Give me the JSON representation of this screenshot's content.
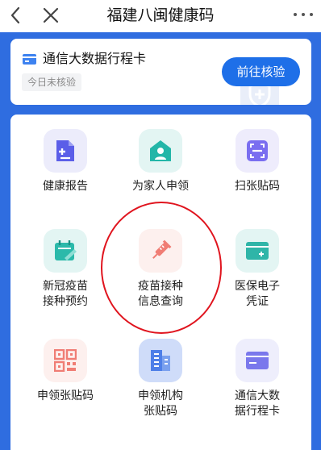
{
  "header": {
    "title": "福建八闽健康码"
  },
  "trip_card": {
    "title": "通信大数据行程卡",
    "status": "今日未核验",
    "button_label": "前往核验"
  },
  "services": [
    {
      "label": "健康报告",
      "icon": "health-report-icon",
      "color": "#5b5ee8"
    },
    {
      "label": "为家人申领",
      "icon": "family-apply-icon",
      "color": "#23b6a8"
    },
    {
      "label": "扫张贴码",
      "icon": "scan-code-icon",
      "color": "#7a6ef0"
    },
    {
      "label": "新冠疫苗\n接种预约",
      "icon": "vaccine-appointment-icon",
      "color": "#2bb9aa"
    },
    {
      "label": "疫苗接种\n信息查询",
      "icon": "syringe-icon",
      "color": "#f07d74"
    },
    {
      "label": "医保电子\n凭证",
      "icon": "medical-card-icon",
      "color": "#2fb5a8"
    },
    {
      "label": "申领张贴码",
      "icon": "qr-code-icon",
      "color": "#f07d74"
    },
    {
      "label": "申领机构\n张贴码",
      "icon": "building-icon",
      "color": "#4e7fe8"
    },
    {
      "label": "通信大数\n据行程卡",
      "icon": "trip-card-icon",
      "color": "#7a78ec"
    }
  ]
}
